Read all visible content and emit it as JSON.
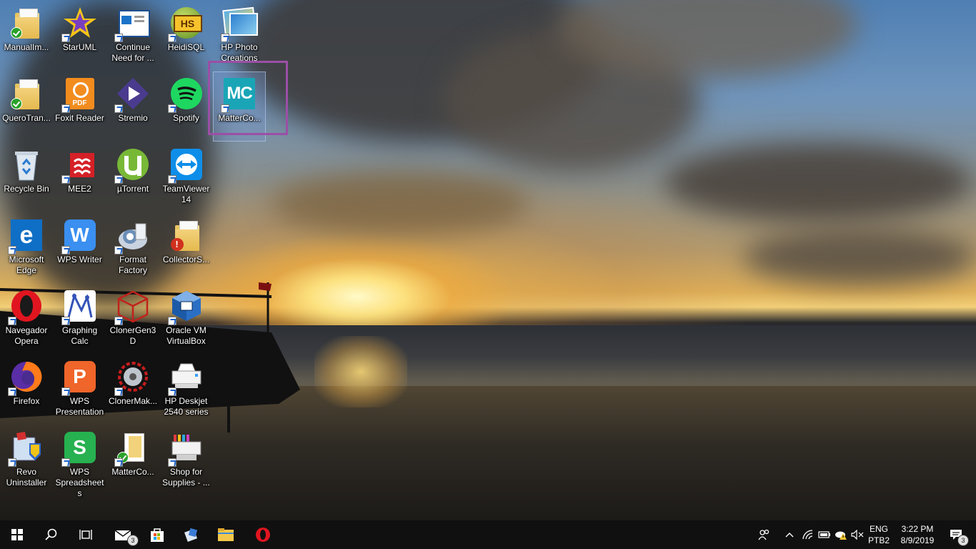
{
  "desktop_icons": [
    {
      "label": "ManualIm...",
      "name": "manualim-folder-icon"
    },
    {
      "label": "StarUML",
      "name": "staruml-icon"
    },
    {
      "label": "Continue Need for ...",
      "name": "continue-nfs-icon"
    },
    {
      "label": "HeidiSQL",
      "name": "heidisql-icon",
      "text": "HS"
    },
    {
      "label": "HP Photo Creations",
      "name": "hp-photo-creations-icon"
    },
    {
      "label": "QueroTran...",
      "name": "querotran-folder-icon"
    },
    {
      "label": "Foxit Reader",
      "name": "foxit-reader-icon",
      "text": "PDF"
    },
    {
      "label": "Stremio",
      "name": "stremio-icon"
    },
    {
      "label": "Spotify",
      "name": "spotify-icon"
    },
    {
      "label": "MatterCo...",
      "name": "mattercontrol-icon",
      "text": "MC"
    },
    {
      "label": "Recycle Bin",
      "name": "recycle-bin-icon"
    },
    {
      "label": "MEE2",
      "name": "mee2-icon"
    },
    {
      "label": "µTorrent",
      "name": "utorrent-icon"
    },
    {
      "label": "TeamViewer 14",
      "name": "teamviewer-icon"
    },
    {
      "label": "Microsoft Edge",
      "name": "microsoft-edge-icon",
      "text": "e"
    },
    {
      "label": "WPS Writer",
      "name": "wps-writer-icon",
      "text": "W"
    },
    {
      "label": "Format Factory",
      "name": "format-factory-icon"
    },
    {
      "label": "CollectorS...",
      "name": "collectors-folder-icon"
    },
    {
      "label": "Navegador Opera",
      "name": "opera-browser-icon"
    },
    {
      "label": "Graphing Calc",
      "name": "graphing-calc-icon"
    },
    {
      "label": "ClonerGen3D",
      "name": "clonergen3d-icon"
    },
    {
      "label": "Oracle VM VirtualBox",
      "name": "virtualbox-icon"
    },
    {
      "label": "Firefox",
      "name": "firefox-icon"
    },
    {
      "label": "WPS Presentation",
      "name": "wps-presentation-icon",
      "text": "P"
    },
    {
      "label": "ClonerMak...",
      "name": "clonermaker-icon"
    },
    {
      "label": "HP Deskjet 2540 series",
      "name": "hp-deskjet-icon"
    },
    {
      "label": "Revo Uninstaller",
      "name": "revo-uninstaller-icon"
    },
    {
      "label": "WPS Spreadsheets",
      "name": "wps-spreadsheets-icon",
      "text": "S"
    },
    {
      "label": "MatterCo...",
      "name": "mattercontrol-doc-icon"
    },
    {
      "label": "Shop for Supplies - ...",
      "name": "shop-supplies-icon"
    }
  ],
  "taskbar": {
    "mail_badge": "3",
    "language": "ENG",
    "layout": "PTB2",
    "time": "3:22 PM",
    "date": "8/9/2019",
    "notification_badge": "3"
  },
  "colors": {
    "highlight": "#9b4fa6",
    "taskbar": "#101010",
    "mc_teal": "#1aa5b7"
  }
}
